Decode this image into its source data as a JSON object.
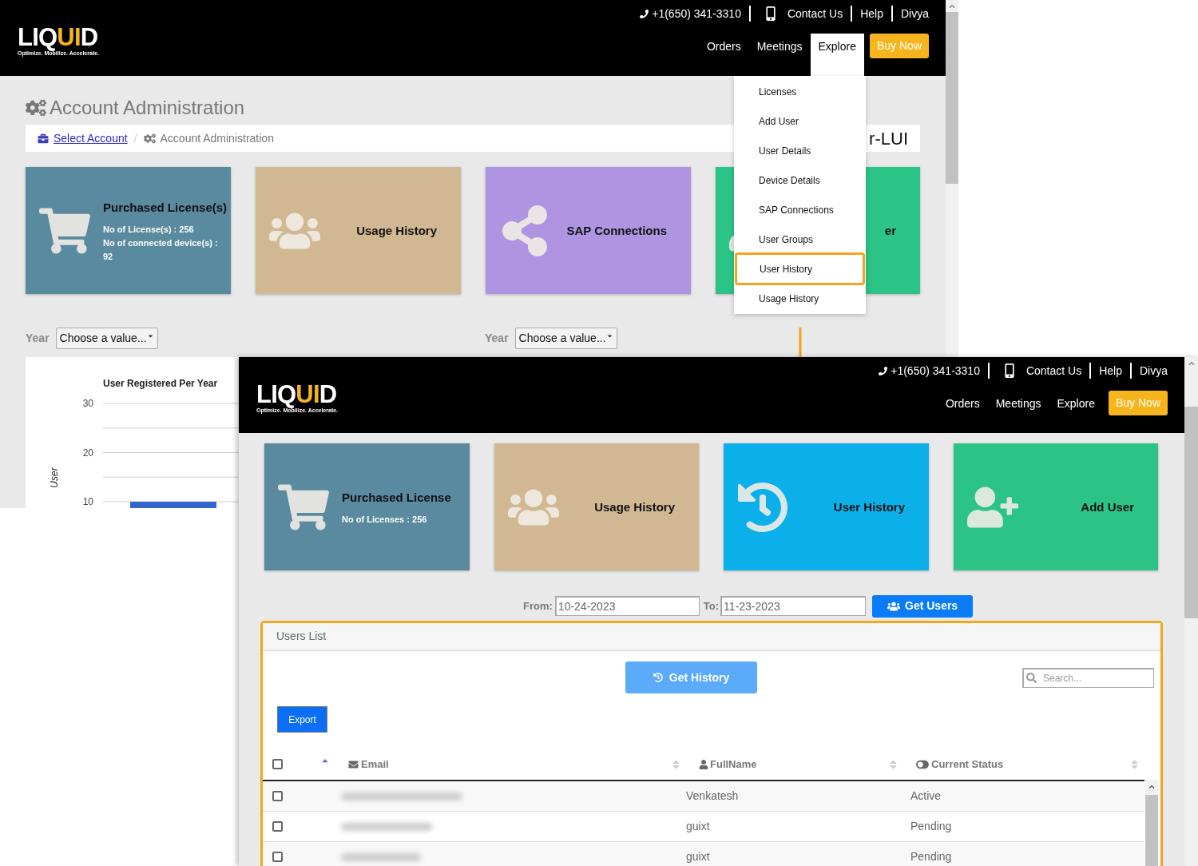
{
  "back_window": {
    "logo": {
      "before": "LIQ",
      "highlight": "UI",
      "after": "D",
      "tagline": "Optimize. Mobilize. Accelerate."
    },
    "top_links": [
      {
        "kind": "phone",
        "label": "+1(650) 341-3310"
      },
      {
        "kind": "contact",
        "label": "Contact Us"
      },
      {
        "kind": "plain",
        "label": "Help"
      },
      {
        "kind": "plain",
        "label": "Divya"
      }
    ],
    "nav": [
      {
        "label": "Orders",
        "selected": false
      },
      {
        "label": "Meetings",
        "selected": false
      },
      {
        "label": "Explore",
        "selected": true
      }
    ],
    "buy_button": "Buy Now",
    "title": "Account Administration",
    "breadcrumb": {
      "link": "Select Account",
      "separator": "/",
      "current": "Account Administration",
      "account": "r-LUI"
    },
    "cards": [
      {
        "kind": "cart",
        "title": "Purchased License(s)",
        "lines": [
          "No of License(s) : 256",
          "No of connected device(s) : 92"
        ],
        "color": "#5a8aa0"
      },
      {
        "kind": "users",
        "title": "Usage History",
        "color": "#d1b892"
      },
      {
        "kind": "share",
        "title": "SAP Connections",
        "color": "#ae94e1"
      },
      {
        "kind": "userplus",
        "title": "er",
        "color": "#2cc486"
      }
    ],
    "filters": [
      {
        "label": "Year",
        "value": "Choose a value..."
      },
      {
        "label": "Year",
        "value": "Choose a value..."
      }
    ],
    "chart_data": {
      "type": "bar",
      "title": "User Registered Per Year",
      "ylabel": "User",
      "ylim": [
        0,
        30
      ],
      "grid": true,
      "yticks": [
        10,
        20,
        30
      ],
      "values": [
        10
      ]
    },
    "menu": [
      {
        "label": "Licenses",
        "selected": false
      },
      {
        "label": "Add User",
        "selected": false
      },
      {
        "label": "User Details",
        "selected": false
      },
      {
        "label": "Device Details",
        "selected": false
      },
      {
        "label": "SAP Connections",
        "selected": false
      },
      {
        "label": "User Groups",
        "selected": false
      },
      {
        "label": "User History",
        "selected": true
      },
      {
        "label": "Usage History",
        "selected": false
      }
    ]
  },
  "front_window": {
    "logo": {
      "before": "LIQ",
      "highlight": "UI",
      "after": "D",
      "tagline": "Optimize. Mobilize. Accelerate."
    },
    "top_links": [
      {
        "kind": "phone",
        "label": "+1(650) 341-3310"
      },
      {
        "kind": "contact",
        "label": "Contact Us"
      },
      {
        "kind": "plain",
        "label": "Help"
      },
      {
        "kind": "plain",
        "label": "Divya"
      }
    ],
    "nav": [
      {
        "label": "Orders",
        "selected": false
      },
      {
        "label": "Meetings",
        "selected": false
      },
      {
        "label": "Explore",
        "selected": false
      }
    ],
    "buy_button": "Buy Now",
    "cards": [
      {
        "kind": "cart",
        "title": "Purchased License",
        "lines": [
          "No of Licenses : 256"
        ],
        "color": "#5a8aa0"
      },
      {
        "kind": "users",
        "title": "Usage History",
        "color": "#d1b892"
      },
      {
        "kind": "history",
        "title": "User History",
        "color": "#0bb0ea"
      },
      {
        "kind": "userplus",
        "title": "Add User",
        "color": "#2cc486"
      }
    ],
    "from": {
      "label": "From:",
      "value": "10-24-2023"
    },
    "to": {
      "label": "To:",
      "value": "11-23-2023"
    },
    "get_users_button": "Get Users",
    "panel": {
      "title": "Users List",
      "get_history_button": "Get History",
      "search": {
        "placeholder": "Search..."
      },
      "export_button": "Export",
      "select_all": {
        "checked": false,
        "sorted": true
      },
      "columns": [
        {
          "kind": "email",
          "label": "Email",
          "sorted": false
        },
        {
          "kind": "user",
          "label": "FullName",
          "sorted": false
        },
        {
          "kind": "status",
          "label": "Current Status",
          "sorted": false
        }
      ],
      "rows": [
        {
          "checked": false,
          "fullname": "Venkatesh",
          "status": "Active"
        },
        {
          "checked": false,
          "fullname": "guixt",
          "status": "Pending"
        },
        {
          "checked": false,
          "fullname": "guixt",
          "status": "Pending"
        }
      ]
    }
  }
}
